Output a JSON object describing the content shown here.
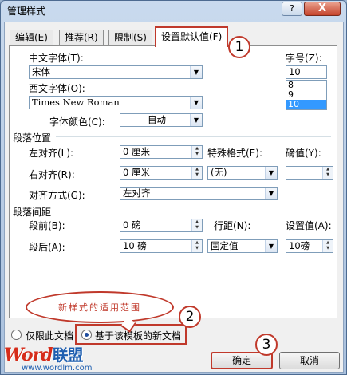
{
  "window": {
    "title": "管理样式",
    "help_label": "?",
    "close_label": "X"
  },
  "tabs": [
    {
      "label": "编辑(E)"
    },
    {
      "label": "推荐(R)"
    },
    {
      "label": "限制(S)"
    },
    {
      "label": "设置默认值(F)",
      "active": true
    }
  ],
  "font": {
    "chinese_label": "中文字体(T):",
    "chinese_value": "宋体",
    "western_label": "西文字体(O):",
    "western_value": "Times New Roman",
    "color_label": "字体颜色(C):",
    "color_value": "自动",
    "size_label": "字号(Z):",
    "size_value": "10",
    "size_options": [
      "8",
      "9",
      "10"
    ],
    "size_selected": "10"
  },
  "paragraph": {
    "title": "段落位置",
    "left_label": "左对齐(L):",
    "left_value": "0 厘米",
    "right_label": "右对齐(R):",
    "right_value": "0 厘米",
    "special_label": "特殊格式(E):",
    "special_value": "(无)",
    "by_label": "磅值(Y):",
    "by_value": "",
    "align_label": "对齐方式(G):",
    "align_value": "左对齐"
  },
  "spacing": {
    "title": "段落间距",
    "before_label": "段前(B):",
    "before_value": "0 磅",
    "after_label": "段后(A):",
    "after_value": "10 磅",
    "line_label": "行距(N):",
    "line_value": "固定值",
    "at_label": "设置值(A):",
    "at_value": "10磅"
  },
  "annotation": {
    "callout_text": "新样式的适用范围",
    "step1": "1",
    "step2": "2",
    "step3": "3"
  },
  "scope": {
    "only_doc_label": "仅限此文档",
    "template_label": "基于该模板的新文档",
    "selected": "template"
  },
  "buttons": {
    "ok_label": "确定",
    "cancel_label": "取消"
  },
  "watermark": {
    "word": "Word",
    "cn": "联盟",
    "url": "www.wordlm.com"
  },
  "colors": {
    "annotation_red": "#c0392b",
    "radio_dot": "#1f4d9e",
    "list_highlight": "#3399ff"
  }
}
